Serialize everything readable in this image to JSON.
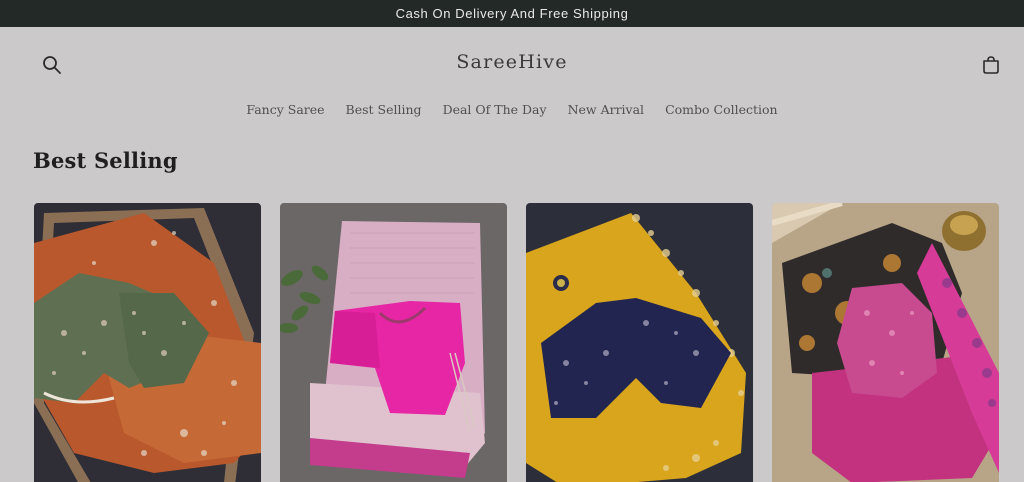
{
  "announcement": {
    "text": "Cash On Delivery And Free Shipping"
  },
  "header": {
    "brand": "SareeHive",
    "search_icon": "search-icon",
    "cart_icon": "cart-icon"
  },
  "nav": {
    "items": [
      {
        "label": "Fancy Saree"
      },
      {
        "label": "Best Selling"
      },
      {
        "label": "Deal Of The Day"
      },
      {
        "label": "New Arrival"
      },
      {
        "label": "Combo Collection"
      }
    ]
  },
  "section": {
    "title": "Best Selling"
  },
  "products": [
    {
      "image": "orange-saree-with-green-embroidered-blouse"
    },
    {
      "image": "pink-silk-saree-with-magenta-blouse"
    },
    {
      "image": "yellow-saree-with-navy-embroidered-blouse"
    },
    {
      "image": "pink-kalamkari-saree-with-embroidered-blouse"
    }
  ],
  "colors": {
    "announcement_bg": "#232927",
    "page_bg": "#cbc9ca"
  }
}
